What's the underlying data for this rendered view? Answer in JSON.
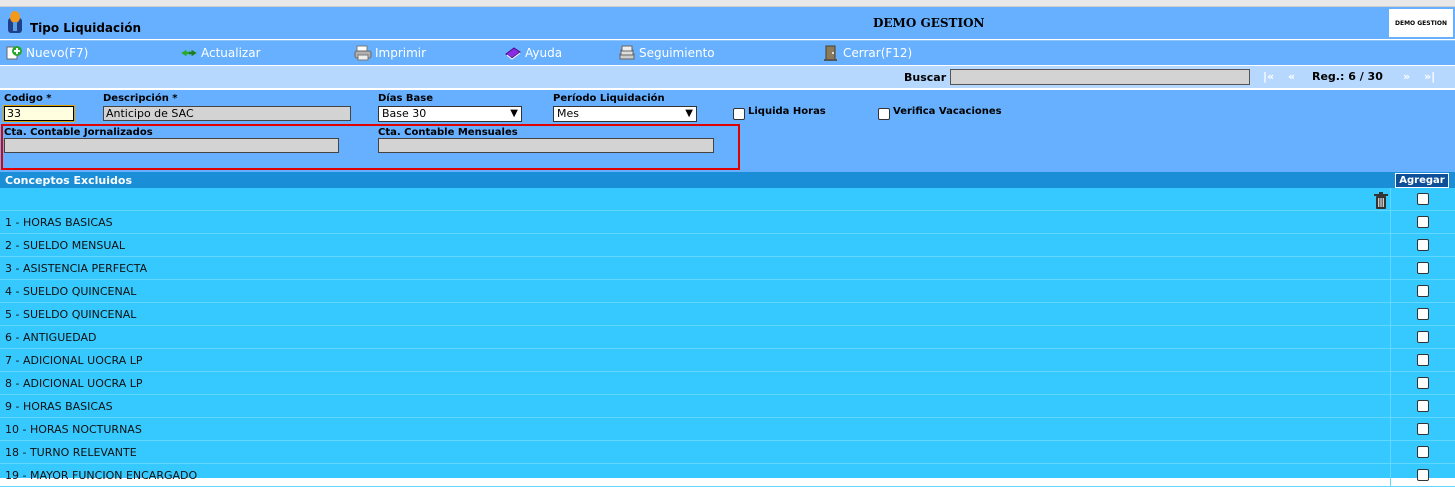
{
  "header": {
    "app_title": "Tipo Liquidación",
    "company": "DEMO GESTION",
    "logo_text": "DEMO GESTION"
  },
  "toolbar": {
    "nuevo": "Nuevo(F7)",
    "actualizar": "Actualizar",
    "imprimir": "Imprimir",
    "ayuda": "Ayuda",
    "seguimiento": "Seguimiento",
    "cerrar": "Cerrar(F12)"
  },
  "nav": {
    "buscar_label": "Buscar",
    "buscar_value": "",
    "first": "|«",
    "prev": "«",
    "reg": "Reg.: 6 / 30",
    "next": "»",
    "last": "»|"
  },
  "form": {
    "codigo_label": "Codigo *",
    "codigo_value": "33",
    "descripcion_label": "Descripción *",
    "descripcion_value": "Anticipo de SAC",
    "dias_base_label": "Días Base",
    "dias_base_value": "Base 30",
    "periodo_label": "Período Liquidación",
    "periodo_value": "Mes",
    "liquida_horas_label": "Liquida Horas",
    "verifica_vacaciones_label": "Verifica Vacaciones",
    "cta_jornalizados_label": "Cta. Contable Jornalizados",
    "cta_jornalizados_value": "",
    "cta_mensuales_label": "Cta. Contable Mensuales",
    "cta_mensuales_value": ""
  },
  "conceptos": {
    "title": "Conceptos Excluidos",
    "agregar_label": "Agregar",
    "rows": [
      "1 - HORAS BASICAS",
      "2 - SUELDO MENSUAL",
      "3 - ASISTENCIA PERFECTA",
      "4 - SUELDO QUINCENAL",
      "5 - SUELDO QUINCENAL",
      "6 - ANTIGUEDAD",
      "7 - ADICIONAL UOCRA LP",
      "8 - ADICIONAL UOCRA LP",
      "9 - HORAS BASICAS",
      "10 - HORAS NOCTURNAS",
      "18 - TURNO RELEVANTE",
      "19 - MAYOR FUNCION ENCARGADO"
    ]
  },
  "colors": {
    "header_blue": "#66b0ff",
    "grid_cyan": "#35c9ff",
    "section_blue": "#1a8fd8",
    "highlight_red": "#e00000"
  }
}
